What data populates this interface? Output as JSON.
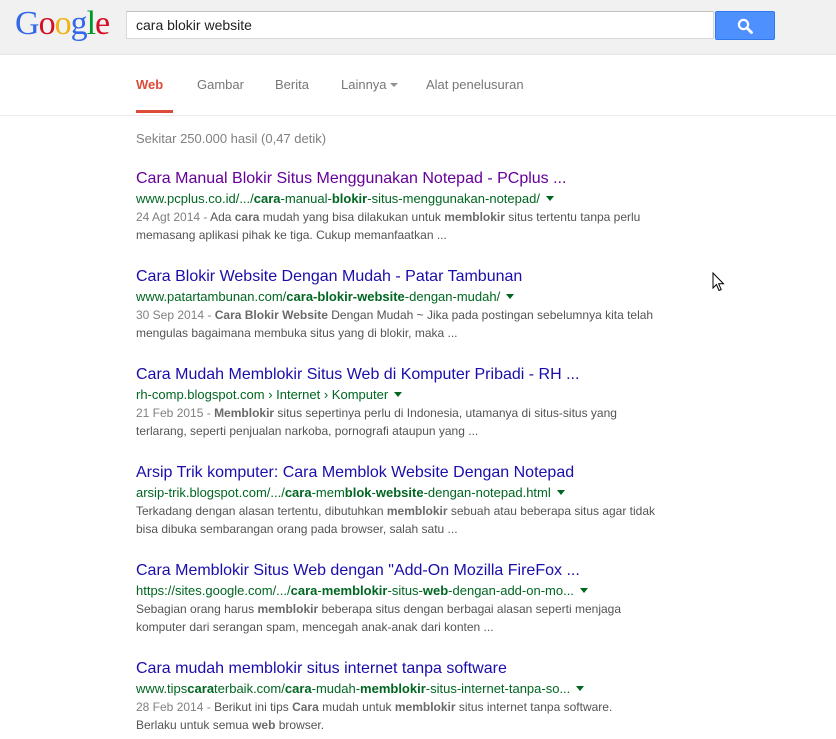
{
  "header": {
    "logo_letters": [
      "G",
      "o",
      "o",
      "g",
      "l",
      "e"
    ],
    "search_value": "cara blokir website"
  },
  "nav": {
    "tabs": [
      {
        "label": "Web",
        "active": true
      },
      {
        "label": "Gambar"
      },
      {
        "label": "Berita"
      },
      {
        "label": "Lainnya",
        "dropdown": true
      },
      {
        "label": "Alat penelusuran"
      }
    ]
  },
  "stats": "Sekitar 250.000 hasil (0,47 detik)",
  "results": [
    {
      "title": "Cara Manual Blokir Situs Menggunakan Notepad - PCplus ...",
      "visited": true,
      "url_parts": [
        [
          "www.pcplus.co.id/.../",
          false
        ],
        [
          "cara",
          true
        ],
        [
          "-manual-",
          false
        ],
        [
          "blokir",
          true
        ],
        [
          "-situs-menggunakan-notepad/",
          false
        ]
      ],
      "snippet_parts": [
        [
          "24 Agt 2014 - ",
          "date"
        ],
        [
          "Ada ",
          ""
        ],
        [
          "cara",
          "b"
        ],
        [
          " mudah yang bisa dilakukan untuk ",
          ""
        ],
        [
          "memblokir",
          "b"
        ],
        [
          " situs tertentu tanpa perlu memasang aplikasi pihak ke tiga. Cukup memanfaatkan ...",
          ""
        ]
      ]
    },
    {
      "title": "Cara Blokir Website Dengan Mudah - Patar Tambunan",
      "url_parts": [
        [
          "www.patartambunan.com/",
          false
        ],
        [
          "cara-blokir-website",
          true
        ],
        [
          "-dengan-mudah/",
          false
        ]
      ],
      "snippet_parts": [
        [
          "30 Sep 2014 - ",
          "date"
        ],
        [
          "Cara Blokir Website",
          "b"
        ],
        [
          " Dengan Mudah ~ Jika pada postingan sebelumnya kita telah mengulas bagaimana membuka situs yang di blokir, maka ...",
          ""
        ]
      ]
    },
    {
      "title": "Cara Mudah Memblokir Situs Web di Komputer Pribadi - RH ...",
      "url_parts": [
        [
          "rh-comp.blogspot.com › Internet › Komputer",
          false
        ]
      ],
      "snippet_parts": [
        [
          "21 Feb 2015 - ",
          "date"
        ],
        [
          "Memblokir",
          "b"
        ],
        [
          " situs sepertinya perlu di Indonesia, utamanya di situs-situs yang terlarang, seperti penjualan narkoba, pornografi ataupun yang ...",
          ""
        ]
      ]
    },
    {
      "title": "Arsip Trik komputer: Cara Memblok Website Dengan Notepad",
      "url_parts": [
        [
          "arsip-trik.blogspot.com/.../",
          false
        ],
        [
          "cara",
          true
        ],
        [
          "-mem",
          false
        ],
        [
          "blok",
          true
        ],
        [
          "-",
          false
        ],
        [
          "website",
          true
        ],
        [
          "-dengan-notepad.html",
          false
        ]
      ],
      "snippet_parts": [
        [
          "Terkadang dengan alasan tertentu, dibutuhkan ",
          ""
        ],
        [
          "memblokir",
          "b"
        ],
        [
          " sebuah atau beberapa situs agar tidak bisa dibuka sembarangan orang pada browser, salah satu ...",
          ""
        ]
      ]
    },
    {
      "title": "Cara Memblokir Situs Web dengan \"Add-On Mozilla FireFox ...",
      "url_parts": [
        [
          "https://sites.google.com/.../",
          false
        ],
        [
          "cara",
          true
        ],
        [
          "-",
          false
        ],
        [
          "memblokir",
          true
        ],
        [
          "-situs-",
          false
        ],
        [
          "web",
          true
        ],
        [
          "-dengan-add-on-mo...",
          false
        ]
      ],
      "snippet_parts": [
        [
          "Sebagian orang harus ",
          ""
        ],
        [
          "memblokir",
          "b"
        ],
        [
          " beberapa situs dengan berbagai alasan seperti menjaga komputer dari serangan spam, mencegah anak-anak dari konten ...",
          ""
        ]
      ]
    },
    {
      "title": "Cara mudah memblokir situs internet tanpa software",
      "url_parts": [
        [
          "www.tips",
          false
        ],
        [
          "cara",
          true
        ],
        [
          "terbaik.com/",
          false
        ],
        [
          "cara",
          true
        ],
        [
          "-mudah-",
          false
        ],
        [
          "memblokir",
          true
        ],
        [
          "-situs-internet-tanpa-so...",
          false
        ]
      ],
      "snippet_parts": [
        [
          "28 Feb 2014 - ",
          "date"
        ],
        [
          "Berikut ini tips ",
          ""
        ],
        [
          "Cara",
          "b"
        ],
        [
          " mudah untuk ",
          ""
        ],
        [
          "memblokir",
          "b"
        ],
        [
          " situs internet tanpa software. Berlaku untuk semua ",
          ""
        ],
        [
          "web",
          "b"
        ],
        [
          " browser.",
          ""
        ]
      ]
    }
  ]
}
